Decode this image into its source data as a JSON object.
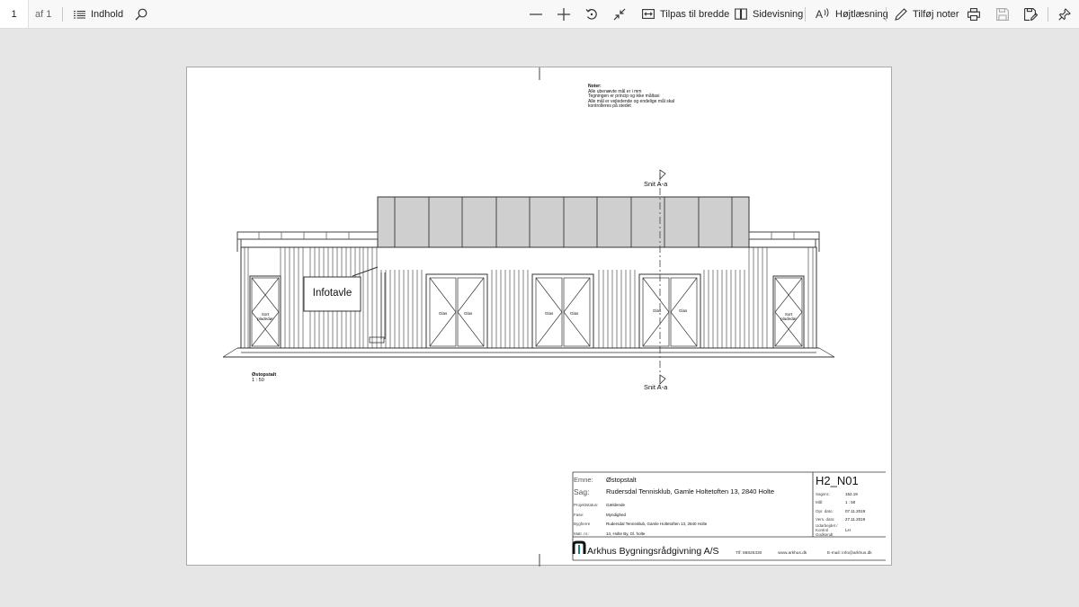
{
  "toolbar": {
    "page_number": "1",
    "page_total": "af 1",
    "contents_label": "Indhold",
    "fit_width_label": "Tilpas til bredde",
    "page_view_label": "Sidevisning",
    "read_aloud_label": "Højtlæsning",
    "add_notes_label": "Tilføj noter"
  },
  "drawing": {
    "notes_title": "Noter:",
    "notes_lines": [
      "Alle ubenævte mål er i mm",
      "Tegningen er princip og ikke måltasi",
      "Alle mål er vejledende og endelige mål skal",
      "kontrolleres på stedet"
    ],
    "section_label": "Snit A-a",
    "info_board": "Infotavle",
    "door_left": [
      "Sort",
      "pladedør"
    ],
    "door_right": [
      "Sort",
      "pladedør"
    ],
    "glass_label": "Glas",
    "view_title": "Østopstalt",
    "view_scale": "1 : 50"
  },
  "titleblock": {
    "emne_label": "Emne:",
    "emne_value": "Østopstalt",
    "sag_label": "Sag:",
    "sag_value": "Rudersdal Tennisklub, Gamle Holtetoften 13, 2840 Holte",
    "drawing_no": "H2_N01",
    "small_rows": [
      {
        "label": "Projektstatus:",
        "value": "Gældende"
      },
      {
        "label": "Fase:",
        "value": "Myndighed"
      },
      {
        "label": "Bygherre",
        "value": "Rudersdal Tennisklub, Gamle Holtetoften 13, 2840 Holte"
      },
      {
        "label": "Matr. nr.:",
        "value": "1ö, Holte By, Gl. holte"
      }
    ],
    "right_rows": [
      {
        "label": "Sagsnr.:",
        "value": "152.19"
      },
      {
        "label": "Mål:",
        "value": "1 : 50"
      },
      {
        "label": "Opr. dato:",
        "value": "07.11.2019"
      },
      {
        "label": "Vers. dato:",
        "value": "27.11.2019"
      },
      {
        "label": "Udarbejdet /",
        "value": "LH"
      },
      {
        "label": "Kontrol",
        "value": ""
      },
      {
        "label": "Godkendt",
        "value": ""
      }
    ],
    "company": "Arkhus Bygningsrådgivning A/S",
    "phone": "Tlf: 88826330",
    "web": "www.arkhus.dk",
    "email": "E-mail: info@arkhus.dk"
  }
}
